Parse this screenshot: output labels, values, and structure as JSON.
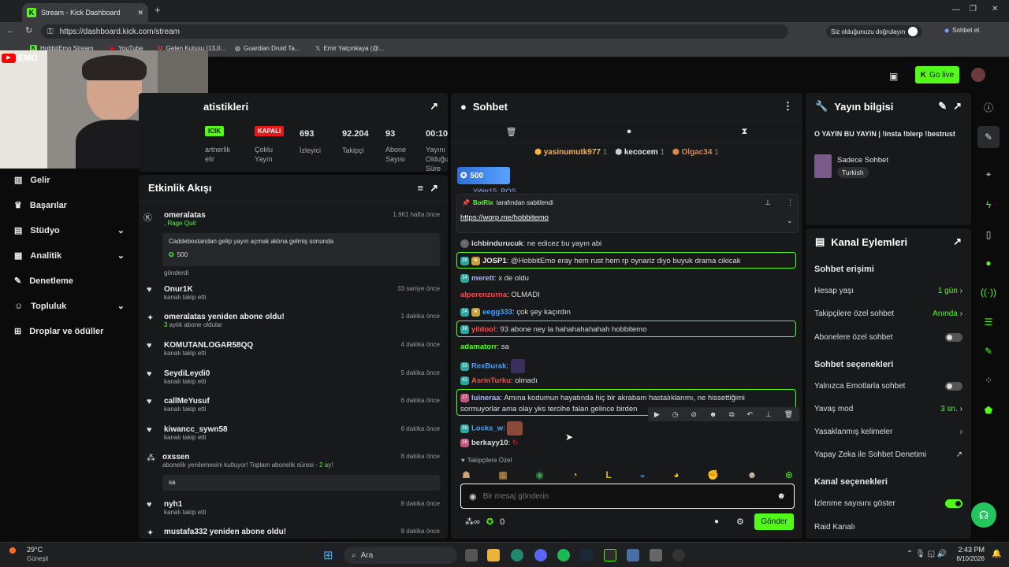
{
  "browser": {
    "tab_title": "Stream - Kick Dashboard",
    "url": "https://dashboard.kick.com/stream",
    "verify_label": "Siz olduğunuzu doğrulayın",
    "copilot_label": "Sohbet et",
    "bookmarks": [
      "HobbitEmo Stream",
      "YouTube",
      "Gelen Kutusu (13,0...",
      "Guardian Druid Ta...",
      "Emir Yalçınkaya (@..."
    ]
  },
  "overlay": {
    "logo_text": "EMO"
  },
  "header": {
    "go_live": "Go live"
  },
  "stats": {
    "title": "atistikleri",
    "badge_green": "ICIK",
    "badge_red": "KAPALI",
    "cells": [
      {
        "label": "artnerlik\nelir"
      },
      {
        "label": "Çoklu\nYayın"
      },
      {
        "value": "693",
        "label": "İzleyici"
      },
      {
        "value": "92.204",
        "label": "Takipçi"
      },
      {
        "value": "93",
        "label": "Abone\nSayısı"
      },
      {
        "value": "00:10:",
        "label": "Yayını\nOlduğu\nSüre"
      }
    ]
  },
  "sidebar": {
    "items": [
      "Gelir",
      "Başarılar",
      "Stüdyo",
      "Analitik",
      "Denetleme",
      "Topluluk",
      "Droplar ve ödüller"
    ]
  },
  "activity": {
    "title": "Etkinlik Akışı",
    "items": [
      {
        "name": "omeralatas",
        "sub": ", Rage Quit",
        "time": "1.961 hafta önce",
        "box": "Caddebostandan gelip yayın açmak aklına gelmiş sonunda",
        "amount": "500",
        "after": "gönderdi"
      },
      {
        "name": "Onur1K",
        "sub": "kanalı takip etti",
        "time": "33 saniye önce"
      },
      {
        "name": "omeralatas yeniden abone oldu!",
        "sub_green": "3",
        "sub": " aylık abone oldular",
        "time": "1 dakika önce"
      },
      {
        "name": "KOMUTANLOGAR58QQ",
        "sub": "kanalı takip etti",
        "time": "4 dakika önce"
      },
      {
        "name": "SeydiLeydi0",
        "sub": "kanalı takip etti",
        "time": "5 dakika önce"
      },
      {
        "name": "callMeYusuf",
        "sub": "kanalı takip etti",
        "time": "6 dakika önce"
      },
      {
        "name": "kiwancc_sywn58",
        "sub": "kanalı takip etti",
        "time": "6 dakika önce"
      },
      {
        "name": "oxssen",
        "sub": "abonelik yenilemesini kutluyor! Toplam abonelik süresi - ",
        "sub_green": "2",
        "sub_end": " ay!",
        "time": "8 dakika önce",
        "box": "sa"
      },
      {
        "name": "nyh1",
        "sub": "kanalı takip etti",
        "time": "8 dakika önce"
      },
      {
        "name": "mustafa332 yeniden abone oldu!",
        "time": "8 dakika önce"
      }
    ]
  },
  "chat": {
    "title": "Sohbet",
    "gifters": [
      {
        "name": "yasinumutk977",
        "n": "1"
      },
      {
        "name": "kecocem",
        "n": "1"
      },
      {
        "name": "Olgac34",
        "n": "1"
      }
    ],
    "gift_total": "500",
    "pinned_by": "BotRix",
    "pinned_label": "tarafından sabitlendi",
    "pinned_link": "https://worp.me/hobbitemo",
    "partial_line": "Yiğitr15: ROS",
    "messages": [
      {
        "user": "ichbindurucuk",
        "color": "#dddddd",
        "text": ": ne edicez bu yayın abi"
      },
      {
        "user": "JOSP1",
        "color": "#dddddd",
        "text": ": @HobbitEmo eray hem rust hem rp oynariz diyo buyuk drama cikicak"
      },
      {
        "user": "merett",
        "color": "#aab4ff",
        "text": ": x de oldu"
      },
      {
        "user": "alperenzurna",
        "color": "#ff4b4b",
        "text": ": OLMADI"
      },
      {
        "user": "eegg333",
        "color": "#4aa3ff",
        "text": ": çok şey kaçırdın"
      },
      {
        "user": "yildoo!",
        "color": "#ff4b4b",
        "text": ": 93 abone ney la hahahahahahah hobbitemo"
      },
      {
        "user": "adamatorr",
        "color": "#53fc18",
        "text": ": sa"
      },
      {
        "user": "RexBurak",
        "color": "#4aa3ff",
        "text": ":"
      },
      {
        "user": "AsrinTurku",
        "color": "#ff4b4b",
        "text": ": olmadı"
      },
      {
        "user": "luineraa",
        "color": "#dddddd",
        "text": ": Amına kodumun hayatında hiç bir akrabam hastalıklarımı, ne hissettiğimi"
      },
      {
        "user": "",
        "color": "#dddddd",
        "text": "sormuyorlar ama olay yks tercihe falan gelince birden"
      },
      {
        "user": "Locks_w",
        "color": "#4aa3ff",
        "text": ":"
      },
      {
        "user": "berkayy10",
        "color": "#dddddd",
        "text": ":"
      }
    ],
    "followers_only": "Takipçilere Özel",
    "input_placeholder": "Bir mesaj gönderin",
    "points": "0",
    "send": "Gönder"
  },
  "stream_info": {
    "title": "Yayın bilgisi",
    "stream_title": "O YAYIN BU YAYIN | !insta !blerp !bestrust",
    "category": "Sadece Sohbet",
    "language": "Turkish"
  },
  "channel_actions": {
    "title": "Kanal Eylemleri",
    "chat_access": "Sohbet erişimi",
    "account_age": "Hesap yaşı",
    "account_age_val": "1 gün",
    "followers_chat": "Takipçilere özel sohbet",
    "followers_chat_val": "Anında",
    "subs_chat": "Abonelere özel sohbet",
    "chat_options": "Sohbet seçenekleri",
    "emotes_only": "Yalnızca Emotlarla sohbet",
    "slow_mode": "Yavaş mod",
    "slow_mode_val": "3 sn.",
    "banned_words": "Yasaklanmış kelimeler",
    "ai_mod": "Yapay Zeka ile Sohbet Denetimi",
    "channel_options": "Kanal seçenekleri",
    "show_viewers": "İzlenme sayısını göster",
    "raid": "Raid Kanalı"
  },
  "taskbar": {
    "temp": "29°C",
    "weather": "Güneşli",
    "search": "Ara",
    "time": "2:43 PM",
    "date": "8/10/2026"
  }
}
